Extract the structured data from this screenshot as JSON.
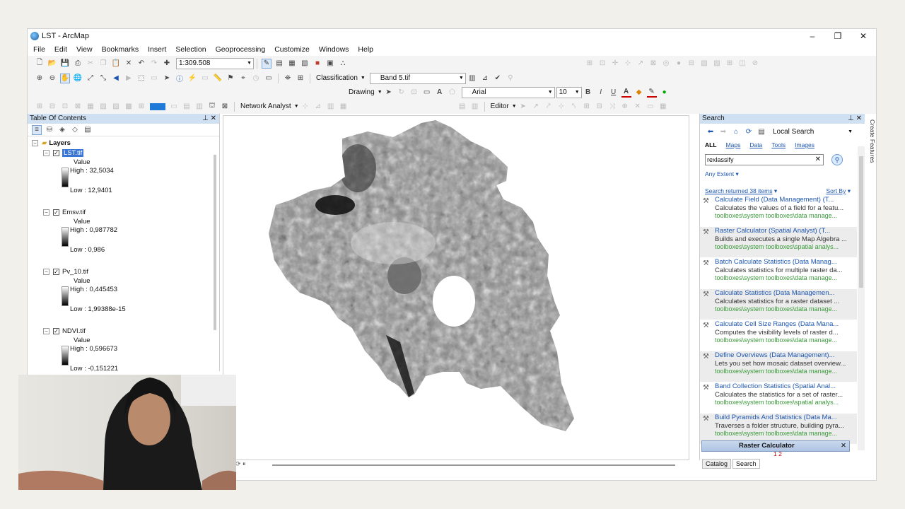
{
  "window": {
    "title": "LST - ArcMap",
    "minimize": "–",
    "maximize": "❐",
    "close": "✕"
  },
  "menu": [
    "File",
    "Edit",
    "View",
    "Bookmarks",
    "Insert",
    "Selection",
    "Geoprocessing",
    "Customize",
    "Windows",
    "Help"
  ],
  "toolbar": {
    "scale": "1:309.508",
    "classification_label": "Classification",
    "band_value": "Band 5.tif",
    "drawing_label": "Drawing",
    "font_value": "Arial",
    "font_size": "10",
    "bold": "B",
    "italic": "I",
    "underline": "U",
    "network_analyst_label": "Network Analyst",
    "editor_label": "Editor"
  },
  "toc": {
    "title": "Table Of Contents",
    "root": "Layers",
    "layers": [
      {
        "name": "LST.tif",
        "value_label": "Value",
        "high": "High : 32,5034",
        "low": "Low : 12,9401",
        "selected": true
      },
      {
        "name": "Emsv.tif",
        "value_label": "Value",
        "high": "High : 0,987782",
        "low": "Low : 0,986"
      },
      {
        "name": "Pv_10.tif",
        "value_label": "Value",
        "high": "High : 0,445453",
        "low": "Low : 1,99388e-15"
      },
      {
        "name": "NDVI.tif",
        "value_label": "Value",
        "high": "High : 0,596673",
        "low": "Low : -0,151221"
      }
    ]
  },
  "search": {
    "title": "Search",
    "scope": "Local Search",
    "tabs": [
      "ALL",
      "Maps",
      "Data",
      "Tools",
      "Images"
    ],
    "query": "rexlassify",
    "extent": "Any Extent",
    "results_count": "Search returned 38 items",
    "sort_by": "Sort By",
    "results": [
      {
        "title": "Calculate Field (Data Management) (T...",
        "desc": "Calculates the values of a field for a featu...",
        "path": "toolboxes\\system toolboxes\\data manage..."
      },
      {
        "title": "Raster Calculator (Spatial Analyst) (T...",
        "desc": "Builds and executes a single Map Algebra ...",
        "path": "toolboxes\\system toolboxes\\spatial analys...",
        "highlight": true
      },
      {
        "title": "Batch Calculate Statistics (Data Manag...",
        "desc": "Calculates statistics for multiple raster da...",
        "path": "toolboxes\\system toolboxes\\data manage..."
      },
      {
        "title": "Calculate Statistics (Data Managemen...",
        "desc": "Calculates statistics for a raster dataset ...",
        "path": "toolboxes\\system toolboxes\\data manage...",
        "highlight": true
      },
      {
        "title": "Calculate Cell Size Ranges (Data Mana...",
        "desc": "Computes the visibility levels of raster d...",
        "path": "toolboxes\\system toolboxes\\data manage..."
      },
      {
        "title": "Define Overviews (Data Management)...",
        "desc": "Lets you set how mosaic dataset overview...",
        "path": "toolboxes\\system toolboxes\\data manage...",
        "highlight": true
      },
      {
        "title": "Band Collection Statistics (Spatial Anal...",
        "desc": "Calculates the statistics for a set of raster...",
        "path": "toolboxes\\system toolboxes\\spatial analys..."
      },
      {
        "title": "Build Pyramids And Statistics (Data Ma...",
        "desc": "Traverses a folder structure, building pyra...",
        "path": "toolboxes\\system toolboxes\\data manage...",
        "highlight": true
      }
    ],
    "pages": "1 2",
    "bottom_tabs": [
      "Catalog",
      "Search"
    ]
  },
  "side_tab": "Create Features",
  "raster_calculator_bar": "Raster Calculator"
}
